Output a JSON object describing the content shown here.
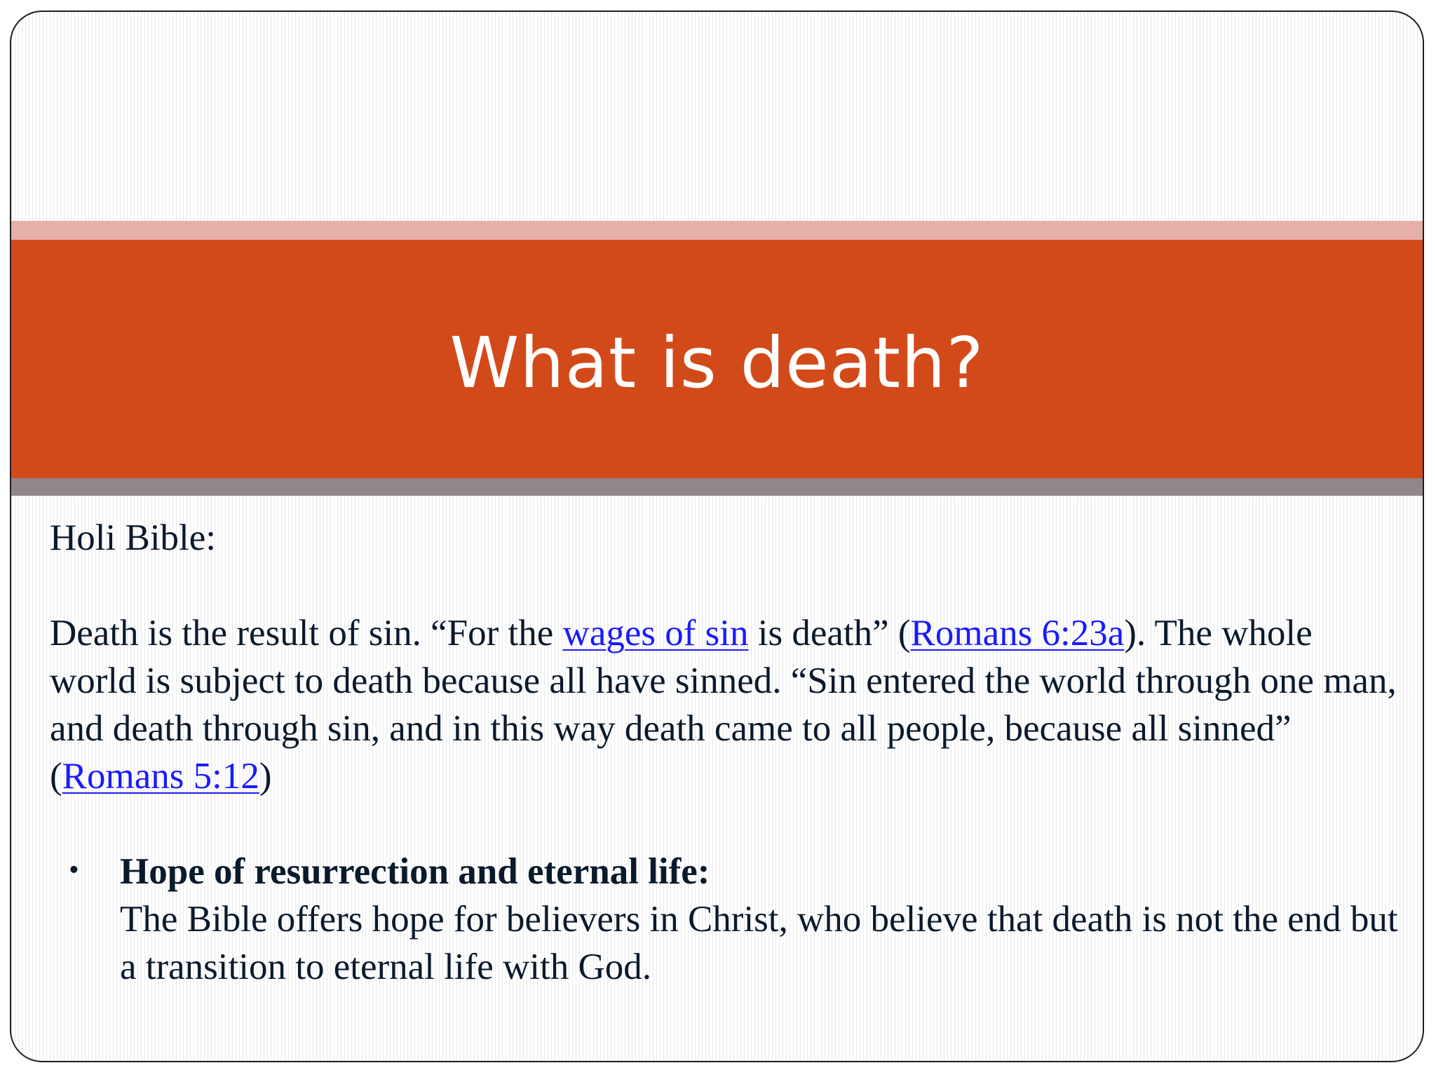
{
  "slide": {
    "title": "What is death?",
    "intro": "Holi Bible:",
    "paragraph": {
      "part1": "Death is the result of sin. “For the ",
      "link1": "wages of sin",
      "part2": " is death” (",
      "link2": "Romans 6:23a",
      "part3": "). The whole world is subject to death because all have sinned. “Sin entered the world through one man, and death through sin, and in this way death came to all people, because all sinned” (",
      "link3": "Romans 5:12",
      "part4": ")"
    },
    "bullet": {
      "marker": "•",
      "heading": "Hope of resurrection and eternal life:",
      "text": "The Bible offers hope for believers in Christ, who believe that death is not the end but a transition to eternal life with God."
    }
  },
  "colors": {
    "title_band": "#d34a1a",
    "title_band_top": "#e6afa8",
    "title_band_bottom": "#918689",
    "link": "#1a1aff",
    "text": "#0b1a2b"
  }
}
